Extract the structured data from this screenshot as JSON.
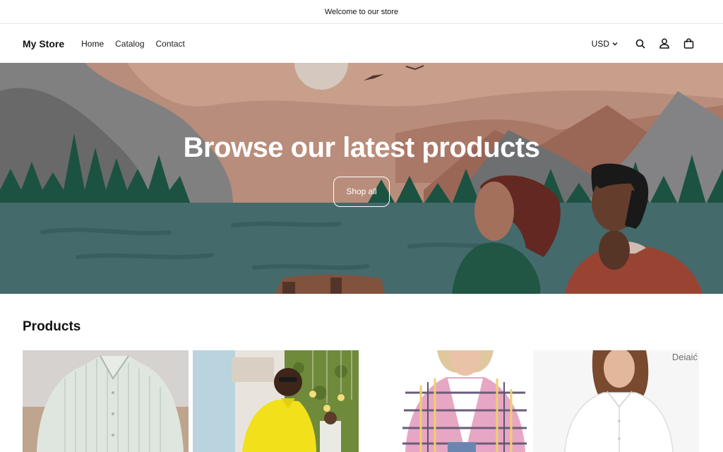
{
  "announcement": {
    "text": "Welcome to our store"
  },
  "header": {
    "logo": "My Store",
    "nav": [
      {
        "label": "Home"
      },
      {
        "label": "Catalog"
      },
      {
        "label": "Contact"
      }
    ],
    "currency": "USD",
    "icons": [
      "search-icon",
      "account-icon",
      "cart-icon"
    ]
  },
  "hero": {
    "title": "Browse our latest products",
    "button_label": "Shop all"
  },
  "products": {
    "heading": "Products",
    "items": [
      {
        "image": "striped-shirt-photo"
      },
      {
        "image": "yellow-shirt-photo"
      },
      {
        "image": "plaid-shacket-photo"
      },
      {
        "image": "white-blouse-photo",
        "watermark": "Deiaić"
      }
    ]
  },
  "colors": {
    "accent": "#121212",
    "background": "#ffffff",
    "hero_water": "#4a7476",
    "hero_sky": "#c99883"
  }
}
